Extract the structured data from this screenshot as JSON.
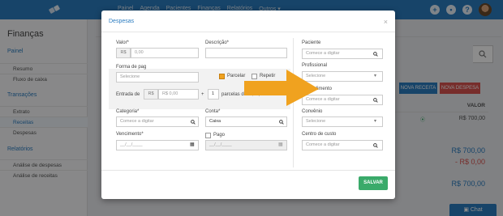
{
  "topbar": {
    "nav": [
      "Painel",
      "Agenda",
      "Pacientes",
      "Finanças",
      "Relatórios",
      "Outros ▾"
    ]
  },
  "sidebar": {
    "title": "Finanças",
    "sections": [
      {
        "label": "Painel",
        "items": [
          "Resumo",
          "Fluxo de caixa"
        ]
      },
      {
        "label": "Transações",
        "items": [
          "Extrato",
          "Receitas",
          "Despesas"
        ]
      },
      {
        "label": "Relatórios",
        "items": [
          "Análise de despesas",
          "Análise de receitas"
        ]
      }
    ],
    "active_item": "Receitas"
  },
  "background": {
    "btn_receita": "NOVA RECEITA",
    "btn_despesa": "NOVA DESPESA",
    "valor_header": "VALOR",
    "row_value": "R$ 700,00",
    "total1": "R$ 700,00",
    "total2": "- R$ 0,00",
    "total3": "R$ 700,00",
    "chat": "Chat"
  },
  "modal": {
    "title": "Despesas",
    "close": "×",
    "valor_label": "Valor*",
    "valor_prefix": "R$",
    "valor_placeholder": "0,00",
    "descricao_label": "Descrição*",
    "forma_label": "Forma de pag",
    "forma_value": "Selecione",
    "parcelar_label": "Parcelar",
    "repetir_label": "Repetir",
    "entrada_label": "Entrada de",
    "entrada_prefix": "R$",
    "entrada_value": "R$ 0,00",
    "plus": "+",
    "parcelas_value": "1",
    "parcelas_text": "parcelas de R$ 0,00",
    "categoria_label": "Categoria*",
    "categoria_placeholder": "Comece a digitar",
    "conta_label": "Conta*",
    "conta_value": "Caixa",
    "vencimento_label": "Vencimento*",
    "vencimento_placeholder": "__/__/____",
    "pago_label": "Pago",
    "pago_date_placeholder": "__/__/____",
    "paciente_label": "Paciente",
    "paciente_placeholder": "Comece a digitar",
    "profissional_label": "Profissional",
    "profissional_value": "Selecione",
    "procedimento_label": "Procedimento",
    "procedimento_placeholder": "Comece a digitar",
    "convenio_label": "Convênio",
    "convenio_value": "Selecione",
    "centro_label": "Centro de custo",
    "centro_placeholder": "Comece a digitar",
    "save": "SALVAR"
  },
  "colors": {
    "primary": "#2b7cc0",
    "success": "#3aaa6a",
    "danger": "#d9534f",
    "arrow": "#f0a21f"
  }
}
